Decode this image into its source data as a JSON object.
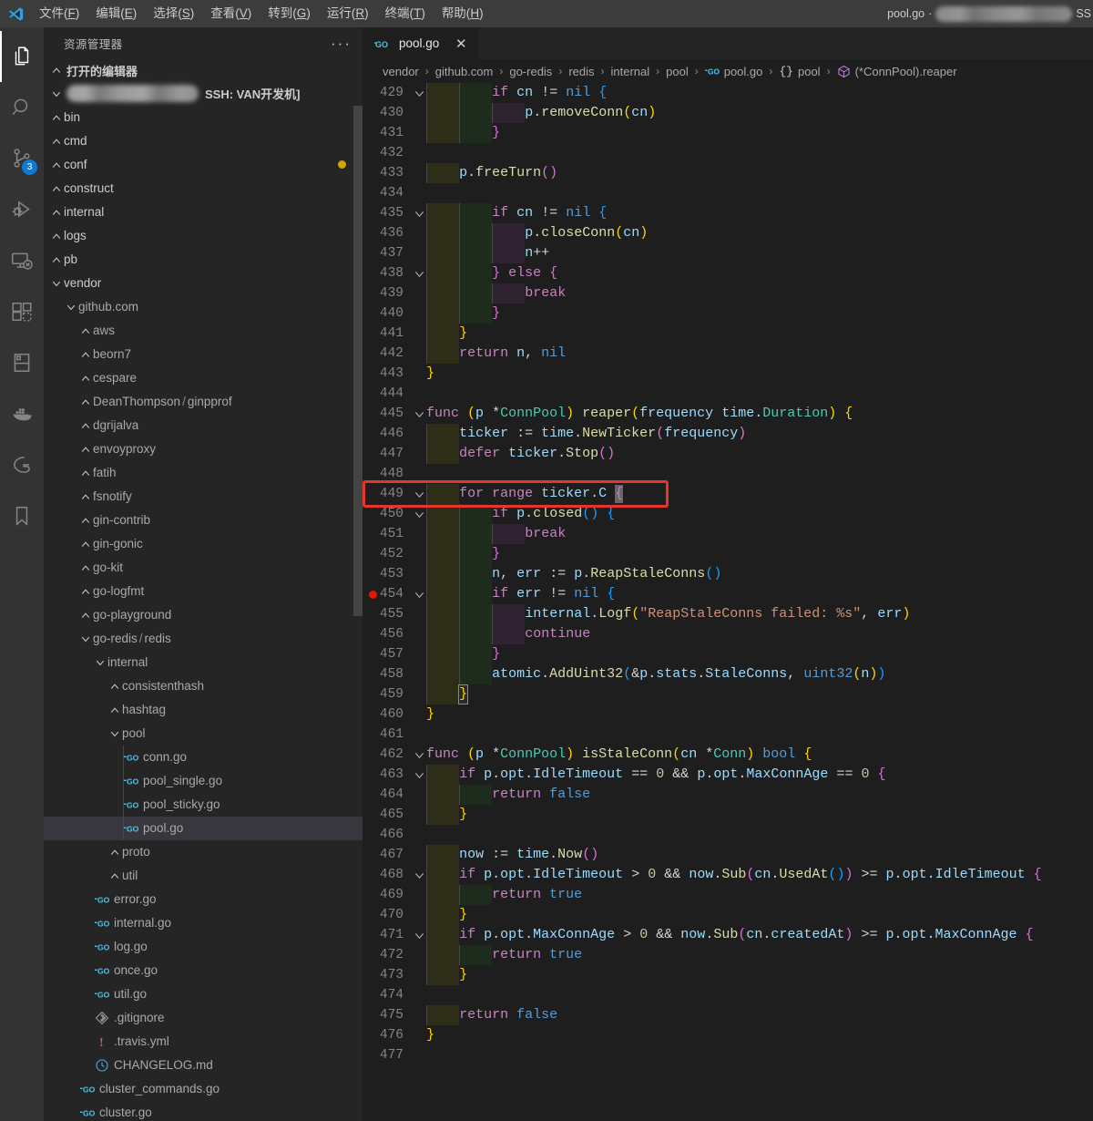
{
  "titlebar": {
    "menus": [
      {
        "label": "文件(F)",
        "mnemonic": "F"
      },
      {
        "label": "编辑(E)",
        "mnemonic": "E"
      },
      {
        "label": "选择(S)",
        "mnemonic": "S"
      },
      {
        "label": "查看(V)",
        "mnemonic": "V"
      },
      {
        "label": "转到(G)",
        "mnemonic": "G"
      },
      {
        "label": "运行(R)",
        "mnemonic": "R"
      },
      {
        "label": "终端(T)",
        "mnemonic": "T"
      },
      {
        "label": "帮助(H)",
        "mnemonic": "H"
      }
    ],
    "window_title_file": "pool.go",
    "window_title_separator": "·",
    "window_title_tail": "SS"
  },
  "activitybar": {
    "items": [
      {
        "name": "explorer",
        "icon": "files-icon",
        "active": true,
        "badge": ""
      },
      {
        "name": "search",
        "icon": "search-icon",
        "active": false,
        "badge": ""
      },
      {
        "name": "source-control",
        "icon": "source-control-icon",
        "active": false,
        "badge": "3"
      },
      {
        "name": "run-and-debug",
        "icon": "run-debug-icon",
        "active": false,
        "badge": ""
      },
      {
        "name": "remote-explorer",
        "icon": "remote-explorer-icon",
        "active": false,
        "badge": ""
      },
      {
        "name": "extensions",
        "icon": "extensions-icon",
        "active": false,
        "badge": ""
      },
      {
        "name": "database",
        "icon": "database-panel-icon",
        "active": false,
        "badge": ""
      },
      {
        "name": "docker",
        "icon": "docker-whale-icon",
        "active": false,
        "badge": ""
      },
      {
        "name": "go",
        "icon": "go-gopher-icon",
        "active": false,
        "badge": ""
      },
      {
        "name": "bookmarks",
        "icon": "bookmark-icon",
        "active": false,
        "badge": ""
      }
    ]
  },
  "sidebar": {
    "title": "资源管理器",
    "more_actions": "···",
    "open_editors_label": "打开的编辑器",
    "root_label_tail": "SSH: VAN开发机]",
    "tree": [
      {
        "label": "bin",
        "depth": 1,
        "kind": "folder",
        "expanded": false
      },
      {
        "label": "cmd",
        "depth": 1,
        "kind": "folder",
        "expanded": false
      },
      {
        "label": "conf",
        "depth": 1,
        "kind": "folder",
        "expanded": false,
        "modified": true
      },
      {
        "label": "construct",
        "depth": 1,
        "kind": "folder",
        "expanded": false
      },
      {
        "label": "internal",
        "depth": 1,
        "kind": "folder",
        "expanded": false
      },
      {
        "label": "logs",
        "depth": 1,
        "kind": "folder",
        "expanded": false
      },
      {
        "label": "pb",
        "depth": 1,
        "kind": "folder",
        "expanded": false
      },
      {
        "label": "vendor",
        "depth": 1,
        "kind": "folder",
        "expanded": true
      },
      {
        "label": "github.com",
        "depth": 2,
        "kind": "folder",
        "expanded": true,
        "dim": true
      },
      {
        "label": "aws",
        "depth": 3,
        "kind": "folder",
        "expanded": false,
        "dim": true
      },
      {
        "label": "beorn7",
        "depth": 3,
        "kind": "folder",
        "expanded": false,
        "dim": true
      },
      {
        "label": "cespare",
        "depth": 3,
        "kind": "folder",
        "expanded": false,
        "dim": true
      },
      {
        "label": "DeanThompson / ginpprof",
        "depth": 3,
        "kind": "folder",
        "expanded": false,
        "dim": true
      },
      {
        "label": "dgrijalva",
        "depth": 3,
        "kind": "folder",
        "expanded": false,
        "dim": true
      },
      {
        "label": "envoyproxy",
        "depth": 3,
        "kind": "folder",
        "expanded": false,
        "dim": true
      },
      {
        "label": "fatih",
        "depth": 3,
        "kind": "folder",
        "expanded": false,
        "dim": true
      },
      {
        "label": "fsnotify",
        "depth": 3,
        "kind": "folder",
        "expanded": false,
        "dim": true
      },
      {
        "label": "gin-contrib",
        "depth": 3,
        "kind": "folder",
        "expanded": false,
        "dim": true
      },
      {
        "label": "gin-gonic",
        "depth": 3,
        "kind": "folder",
        "expanded": false,
        "dim": true
      },
      {
        "label": "go-kit",
        "depth": 3,
        "kind": "folder",
        "expanded": false,
        "dim": true
      },
      {
        "label": "go-logfmt",
        "depth": 3,
        "kind": "folder",
        "expanded": false,
        "dim": true
      },
      {
        "label": "go-playground",
        "depth": 3,
        "kind": "folder",
        "expanded": false,
        "dim": true
      },
      {
        "label": "go-redis / redis",
        "depth": 3,
        "kind": "folder",
        "expanded": true,
        "dim": true
      },
      {
        "label": "internal",
        "depth": 4,
        "kind": "folder",
        "expanded": true,
        "dim": true
      },
      {
        "label": "consistenthash",
        "depth": 5,
        "kind": "folder",
        "expanded": false,
        "dim": true
      },
      {
        "label": "hashtag",
        "depth": 5,
        "kind": "folder",
        "expanded": false,
        "dim": true
      },
      {
        "label": "pool",
        "depth": 5,
        "kind": "folder",
        "expanded": true,
        "dim": true
      },
      {
        "label": "conn.go",
        "depth": 6,
        "kind": "go",
        "dim": true
      },
      {
        "label": "pool_single.go",
        "depth": 6,
        "kind": "go",
        "dim": true
      },
      {
        "label": "pool_sticky.go",
        "depth": 6,
        "kind": "go",
        "dim": true
      },
      {
        "label": "pool.go",
        "depth": 6,
        "kind": "go",
        "dim": true,
        "selected": true
      },
      {
        "label": "proto",
        "depth": 5,
        "kind": "folder",
        "expanded": false,
        "dim": true
      },
      {
        "label": "util",
        "depth": 5,
        "kind": "folder",
        "expanded": false,
        "dim": true
      },
      {
        "label": "error.go",
        "depth": 4,
        "kind": "go",
        "dim": true
      },
      {
        "label": "internal.go",
        "depth": 4,
        "kind": "go",
        "dim": true
      },
      {
        "label": "log.go",
        "depth": 4,
        "kind": "go",
        "dim": true
      },
      {
        "label": "once.go",
        "depth": 4,
        "kind": "go",
        "dim": true
      },
      {
        "label": "util.go",
        "depth": 4,
        "kind": "go",
        "dim": true
      },
      {
        "label": ".gitignore",
        "depth": 4,
        "kind": "git",
        "dim": true
      },
      {
        "label": ".travis.yml",
        "depth": 4,
        "kind": "travis",
        "dim": true
      },
      {
        "label": "CHANGELOG.md",
        "depth": 4,
        "kind": "changelog",
        "dim": true
      },
      {
        "label": "cluster_commands.go",
        "depth": 3,
        "kind": "go",
        "dim": true
      },
      {
        "label": "cluster.go",
        "depth": 3,
        "kind": "go",
        "dim": true
      }
    ]
  },
  "editor": {
    "tab": {
      "label": "pool.go",
      "icon": "go-file-icon",
      "close_label": "✕",
      "active": true
    },
    "breadcrumbs": [
      {
        "label": "vendor",
        "icon": ""
      },
      {
        "label": "github.com",
        "icon": ""
      },
      {
        "label": "go-redis",
        "icon": ""
      },
      {
        "label": "redis",
        "icon": ""
      },
      {
        "label": "internal",
        "icon": ""
      },
      {
        "label": "pool",
        "icon": ""
      },
      {
        "label": "pool.go",
        "icon": "go-file-icon"
      },
      {
        "label": "pool",
        "icon": "namespace-icon"
      },
      {
        "label": "(*ConnPool).reaper",
        "icon": "method-icon"
      }
    ],
    "breadcrumb_separator": "›",
    "first_line": 429,
    "breakpoint_line": 454,
    "cursor_line": 449,
    "annotation": {
      "color": "#e8352b",
      "target_line": 449,
      "label": "for range ticker.C {"
    },
    "lines": [
      {
        "n": 429,
        "fold": "open",
        "indents": [
          1,
          2
        ],
        "code": "        if cn != nil {"
      },
      {
        "n": 430,
        "fold": "",
        "indents": [
          1,
          2,
          3
        ],
        "code": "            p.removeConn(cn)"
      },
      {
        "n": 431,
        "fold": "",
        "indents": [
          1,
          2
        ],
        "code": "        }"
      },
      {
        "n": 432,
        "fold": "",
        "indents": [],
        "code": ""
      },
      {
        "n": 433,
        "fold": "",
        "indents": [
          1
        ],
        "code": "    p.freeTurn()"
      },
      {
        "n": 434,
        "fold": "",
        "indents": [],
        "code": ""
      },
      {
        "n": 435,
        "fold": "open",
        "indents": [
          1,
          2
        ],
        "code": "        if cn != nil {"
      },
      {
        "n": 436,
        "fold": "",
        "indents": [
          1,
          2,
          3
        ],
        "code": "            p.closeConn(cn)"
      },
      {
        "n": 437,
        "fold": "",
        "indents": [
          1,
          2,
          3
        ],
        "code": "            n++"
      },
      {
        "n": 438,
        "fold": "open",
        "indents": [
          1,
          2
        ],
        "code": "        } else {"
      },
      {
        "n": 439,
        "fold": "",
        "indents": [
          1,
          2,
          3
        ],
        "code": "            break"
      },
      {
        "n": 440,
        "fold": "",
        "indents": [
          1,
          2
        ],
        "code": "        }"
      },
      {
        "n": 441,
        "fold": "",
        "indents": [
          1
        ],
        "code": "    }"
      },
      {
        "n": 442,
        "fold": "",
        "indents": [
          1
        ],
        "code": "    return n, nil"
      },
      {
        "n": 443,
        "fold": "",
        "indents": [],
        "code": "}"
      },
      {
        "n": 444,
        "fold": "",
        "indents": [],
        "code": ""
      },
      {
        "n": 445,
        "fold": "open",
        "indents": [],
        "code": "func (p *ConnPool) reaper(frequency time.Duration) {"
      },
      {
        "n": 446,
        "fold": "",
        "indents": [
          1
        ],
        "code": "    ticker := time.NewTicker(frequency)"
      },
      {
        "n": 447,
        "fold": "",
        "indents": [
          1
        ],
        "code": "    defer ticker.Stop()"
      },
      {
        "n": 448,
        "fold": "",
        "indents": [],
        "code": ""
      },
      {
        "n": 449,
        "fold": "open",
        "indents": [
          1
        ],
        "code": "    for range ticker.C {"
      },
      {
        "n": 450,
        "fold": "open",
        "indents": [
          1,
          2
        ],
        "code": "        if p.closed() {"
      },
      {
        "n": 451,
        "fold": "",
        "indents": [
          1,
          2,
          3
        ],
        "code": "            break"
      },
      {
        "n": 452,
        "fold": "",
        "indents": [
          1,
          2
        ],
        "code": "        }"
      },
      {
        "n": 453,
        "fold": "",
        "indents": [
          1,
          2
        ],
        "code": "        n, err := p.ReapStaleConns()"
      },
      {
        "n": 454,
        "fold": "open",
        "indents": [
          1,
          2
        ],
        "code": "        if err != nil {"
      },
      {
        "n": 455,
        "fold": "",
        "indents": [
          1,
          2,
          3
        ],
        "code": "            internal.Logf(\"ReapStaleConns failed: %s\", err)"
      },
      {
        "n": 456,
        "fold": "",
        "indents": [
          1,
          2,
          3
        ],
        "code": "            continue"
      },
      {
        "n": 457,
        "fold": "",
        "indents": [
          1,
          2
        ],
        "code": "        }"
      },
      {
        "n": 458,
        "fold": "",
        "indents": [
          1,
          2
        ],
        "code": "        atomic.AddUint32(&p.stats.StaleConns, uint32(n))"
      },
      {
        "n": 459,
        "fold": "",
        "indents": [
          1
        ],
        "code": "    }"
      },
      {
        "n": 460,
        "fold": "",
        "indents": [],
        "code": "}"
      },
      {
        "n": 461,
        "fold": "",
        "indents": [],
        "code": ""
      },
      {
        "n": 462,
        "fold": "open",
        "indents": [],
        "code": "func (p *ConnPool) isStaleConn(cn *Conn) bool {"
      },
      {
        "n": 463,
        "fold": "open",
        "indents": [
          1
        ],
        "code": "    if p.opt.IdleTimeout == 0 && p.opt.MaxConnAge == 0 {"
      },
      {
        "n": 464,
        "fold": "",
        "indents": [
          1,
          2
        ],
        "code": "        return false"
      },
      {
        "n": 465,
        "fold": "",
        "indents": [
          1
        ],
        "code": "    }"
      },
      {
        "n": 466,
        "fold": "",
        "indents": [],
        "code": ""
      },
      {
        "n": 467,
        "fold": "",
        "indents": [
          1
        ],
        "code": "    now := time.Now()"
      },
      {
        "n": 468,
        "fold": "open",
        "indents": [
          1
        ],
        "code": "    if p.opt.IdleTimeout > 0 && now.Sub(cn.UsedAt()) >= p.opt.IdleTimeout {"
      },
      {
        "n": 469,
        "fold": "",
        "indents": [
          1,
          2
        ],
        "code": "        return true"
      },
      {
        "n": 470,
        "fold": "",
        "indents": [
          1
        ],
        "code": "    }"
      },
      {
        "n": 471,
        "fold": "open",
        "indents": [
          1
        ],
        "code": "    if p.opt.MaxConnAge > 0 && now.Sub(cn.createdAt) >= p.opt.MaxConnAge {"
      },
      {
        "n": 472,
        "fold": "",
        "indents": [
          1,
          2
        ],
        "code": "        return true"
      },
      {
        "n": 473,
        "fold": "",
        "indents": [
          1
        ],
        "code": "    }"
      },
      {
        "n": 474,
        "fold": "",
        "indents": [],
        "code": ""
      },
      {
        "n": 475,
        "fold": "",
        "indents": [
          1
        ],
        "code": "    return false"
      },
      {
        "n": 476,
        "fold": "",
        "indents": [],
        "code": "}"
      },
      {
        "n": 477,
        "fold": "",
        "indents": [],
        "code": ""
      }
    ]
  },
  "colors": {
    "titlebar_bg": "#3c3c3c",
    "activitybar_bg": "#333333",
    "sidebar_bg": "#252526",
    "editor_bg": "#1e1e1e",
    "accent_blue": "#0e7ad4",
    "annotation_red": "#e8352b",
    "breakpoint_red": "#e51400",
    "modified_dot": "#cca700",
    "go_icon_blue": "#4fc3e8"
  }
}
